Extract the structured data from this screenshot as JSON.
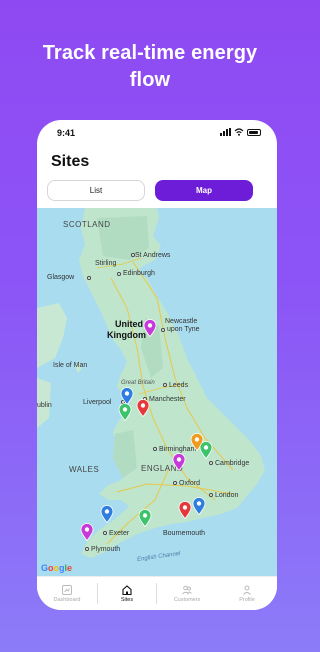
{
  "headline": {
    "line1": "Track real-time energy",
    "line2": "flow"
  },
  "status_bar": {
    "time": "9:41"
  },
  "page": {
    "title": "Sites"
  },
  "view_toggle": {
    "list_label": "List",
    "map_label": "Map",
    "selected": "Map"
  },
  "map": {
    "labels": {
      "scotland": "SCOTLAND",
      "st_andrews": "St Andrews",
      "stirling": "Stirling",
      "glasgow": "Glasgow",
      "edinburgh": "Edinburgh",
      "united_kingdom_1": "United",
      "united_kingdom_2": "Kingdom",
      "newcastle_1": "Newcastle",
      "newcastle_2": "upon Tyne",
      "isle_of_man": "Isle of Man",
      "great_britain": "Great Britain",
      "leeds": "Leeds",
      "dublin": "ublin",
      "liverpool": "Liverpool",
      "manchester": "Manchester",
      "birmingham": "Birmingham",
      "wales": "WALES",
      "england": "ENGLAND",
      "cambridge": "Cambridge",
      "oxford": "Oxford",
      "london": "London",
      "exeter": "Exeter",
      "bournemouth": "Bournemouth",
      "plymouth": "Plymouth",
      "english_channel": "English Channel"
    },
    "attribution": [
      "G",
      "o",
      "o",
      "g",
      "l",
      "e"
    ],
    "pin_colors": {
      "blue": "#2f7de1",
      "green": "#3cc36b",
      "red": "#e5383b",
      "purple": "#c53ad9",
      "orange": "#f19b1c"
    }
  },
  "tabbar": {
    "items": [
      {
        "label": "Dashboard",
        "icon": "dashboard-icon"
      },
      {
        "label": "Sites",
        "icon": "home-icon"
      },
      {
        "label": "Customers",
        "icon": "users-icon"
      },
      {
        "label": "Profile",
        "icon": "profile-icon"
      }
    ],
    "active": "Sites"
  },
  "colors": {
    "accent": "#6d1cd8",
    "background_top": "#8f49f2",
    "background_bottom": "#8c7cf8",
    "water": "#a9dcef",
    "land": "#bfe5cd"
  }
}
